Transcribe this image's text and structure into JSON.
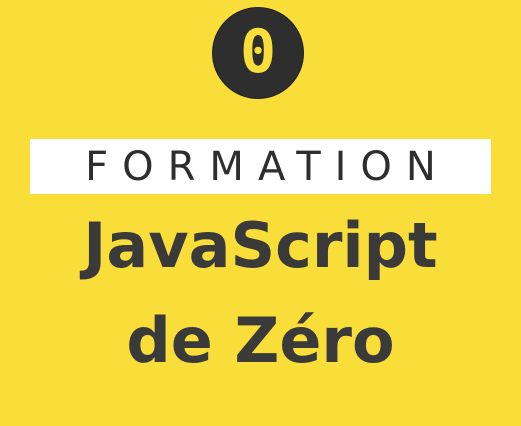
{
  "logo": {
    "glyph": "0",
    "icon": "zero-badge-icon"
  },
  "banner": {
    "label": "FORMATION"
  },
  "title": {
    "line1": "JavaScript",
    "line2": "de Zéro"
  },
  "colors": {
    "background": "#f9dd38",
    "dark": "#2e2e2e",
    "banner_bg": "#ffffff"
  }
}
